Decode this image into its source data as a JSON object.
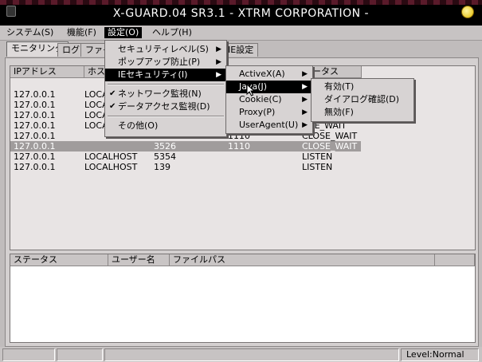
{
  "window": {
    "title": "X-GUARD.04 SR3.1 - XTRM CORPORATION -"
  },
  "menubar": {
    "items": [
      "システム(S)",
      "機能(F)",
      "設定(O)",
      "ヘルプ(H)"
    ]
  },
  "tabs": [
    "モニタリング",
    "ログ",
    "ファイ",
    "IE設定"
  ],
  "connections": {
    "headers": [
      "IPアドレス",
      "ホス",
      "",
      "",
      "テータス"
    ],
    "rows": [
      [
        "127.0.0.1",
        "LOCA",
        "",
        "",
        ""
      ],
      [
        "127.0.0.1",
        "LOCA",
        "",
        "",
        ""
      ],
      [
        "127.0.0.1",
        "LOCA",
        "",
        "",
        ""
      ],
      [
        "127.0.0.1",
        "LOCA",
        "",
        "",
        ""
      ],
      [
        "127.0.0.1",
        "",
        "3524",
        "1110",
        "CLOSE_WAIT"
      ],
      [
        "127.0.0.1",
        "",
        "3526",
        "1110",
        "CLOSE_WAIT"
      ],
      [
        "127.0.0.1",
        "LOCALHOST",
        "5354",
        "",
        "LISTEN"
      ],
      [
        "127.0.0.1",
        "LOCALHOST",
        "139",
        "",
        "LISTEN"
      ]
    ],
    "extra_status": [
      "OSE_WAIT"
    ]
  },
  "files": {
    "headers": [
      "ステータス",
      "ユーザー名",
      "ファイルパス",
      ""
    ]
  },
  "statusbar": {
    "level": "Level:Normal"
  },
  "settings_menu": {
    "items": [
      {
        "label": "セキュリティレベル(S)",
        "submenu": true
      },
      {
        "label": "ポップアップ防止(P)",
        "submenu": true
      },
      {
        "label": "IEセキュリティ(I)",
        "submenu": true,
        "highlighted": true
      },
      {
        "label": "ネットワーク監視(N)",
        "checked": true
      },
      {
        "label": "データアクセス監視(D)",
        "checked": true
      },
      {
        "label": "その他(O)"
      }
    ]
  },
  "ie_menu": {
    "items": [
      {
        "label": "ActiveX(A)",
        "submenu": true
      },
      {
        "label": "Java(J)",
        "submenu": true,
        "highlighted": true
      },
      {
        "label": "Cookie(C)",
        "submenu": true
      },
      {
        "label": "Proxy(P)",
        "submenu": true
      },
      {
        "label": "UserAgent(U)",
        "submenu": true
      }
    ]
  },
  "java_menu": {
    "items": [
      {
        "label": "有効(T)"
      },
      {
        "label": "ダイアログ確認(D)"
      },
      {
        "label": "無効(F)"
      }
    ]
  },
  "colors": {
    "menu_highlight": "#000000",
    "selected_row": "#a09c9c",
    "titlebar": "#000000"
  },
  "icons": {
    "check": "✔",
    "submenu_arrow": "▶"
  }
}
